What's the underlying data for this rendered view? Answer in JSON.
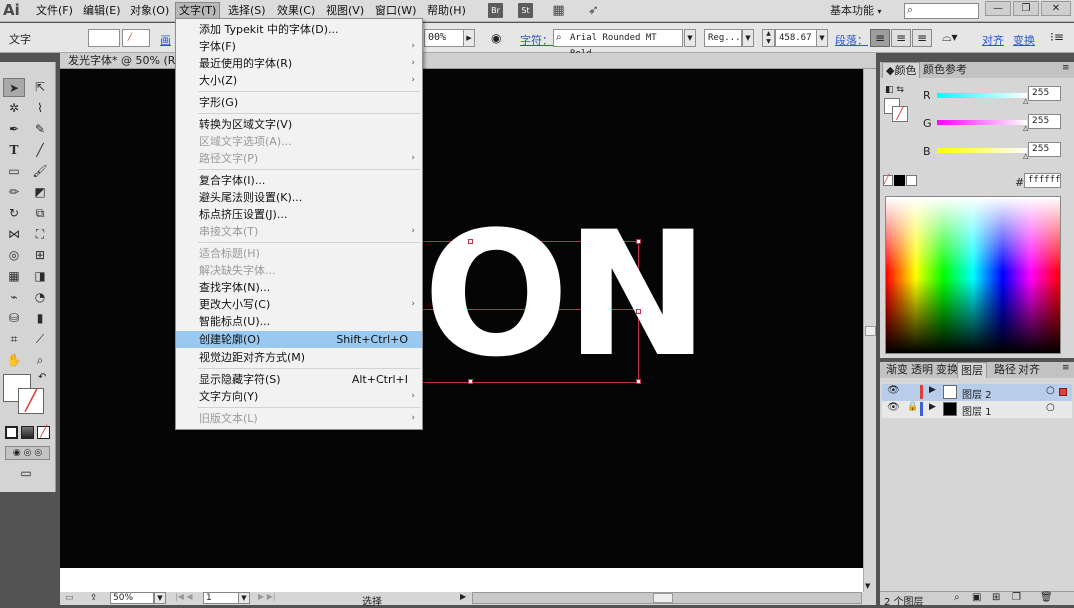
{
  "menubar": {
    "logo": "Ai",
    "items": [
      "文件(F)",
      "编辑(E)",
      "对象(O)",
      "文字(T)",
      "选择(S)",
      "效果(C)",
      "视图(V)",
      "窗口(W)",
      "帮助(H)"
    ],
    "icons": [
      "Br",
      "St"
    ],
    "workspace": "基本功能",
    "search_placeholder": ""
  },
  "control_bar": {
    "label": "文字",
    "zoom_value": "00%",
    "char_link": "字符：",
    "font_name": "Arial Rounded MT Bold",
    "font_style": "Reg...",
    "font_size": "458.67",
    "para_link": "段落：",
    "align_link": "对齐",
    "transform_link": "变换",
    "left_partial": "画"
  },
  "document": {
    "tab_title": "发光字体* @ 50% (RG",
    "canvas_text": "ON",
    "zoom": "50%",
    "page": "1",
    "status": "选择"
  },
  "type_menu": {
    "items": [
      {
        "label": "添加 Typekit 中的字体(D)...",
        "enabled": true
      },
      {
        "label": "字体(F)",
        "enabled": true,
        "submenu": true
      },
      {
        "label": "最近使用的字体(R)",
        "enabled": true,
        "submenu": true
      },
      {
        "label": "大小(Z)",
        "enabled": true,
        "submenu": true
      },
      {
        "label": "字形(G)",
        "enabled": true
      },
      {
        "label": "转换为区域文字(V)",
        "enabled": true
      },
      {
        "label": "区域文字选项(A)...",
        "enabled": false
      },
      {
        "label": "路径文字(P)",
        "enabled": false,
        "submenu": true
      },
      {
        "label": "复合字体(I)...",
        "enabled": true
      },
      {
        "label": "避头尾法则设置(K)...",
        "enabled": true
      },
      {
        "label": "标点挤压设置(J)...",
        "enabled": true
      },
      {
        "label": "串接文本(T)",
        "enabled": false,
        "submenu": true
      },
      {
        "label": "适合标题(H)",
        "enabled": false
      },
      {
        "label": "解决缺失字体...",
        "enabled": false
      },
      {
        "label": "查找字体(N)...",
        "enabled": true
      },
      {
        "label": "更改大小写(C)",
        "enabled": true,
        "submenu": true
      },
      {
        "label": "智能标点(U)...",
        "enabled": true
      },
      {
        "label": "创建轮廓(O)",
        "enabled": true,
        "shortcut": "Shift+Ctrl+O",
        "highlighted": true
      },
      {
        "label": "视觉边距对齐方式(M)",
        "enabled": true
      },
      {
        "label": "显示隐藏字符(S)",
        "enabled": true,
        "shortcut": "Alt+Ctrl+I"
      },
      {
        "label": "文字方向(Y)",
        "enabled": true,
        "submenu": true
      },
      {
        "label": "旧版文本(L)",
        "enabled": false,
        "submenu": true
      }
    ]
  },
  "color_panel": {
    "tabs": [
      "颜色",
      "颜色参考"
    ],
    "channels": [
      {
        "name": "R",
        "value": "255"
      },
      {
        "name": "G",
        "value": "255"
      },
      {
        "name": "B",
        "value": "255"
      }
    ],
    "hex_label": "#",
    "hex": "ffffff"
  },
  "layers_panel": {
    "tabs": [
      "渐变",
      "透明",
      "变换",
      "图层",
      "路径",
      "对齐"
    ],
    "layers": [
      "图层 2",
      "图层 1"
    ],
    "count": "2 个图层"
  },
  "colors": {
    "highlight": "#99c9f1",
    "accent_red": "#e0403a",
    "canvas": "#050505"
  }
}
